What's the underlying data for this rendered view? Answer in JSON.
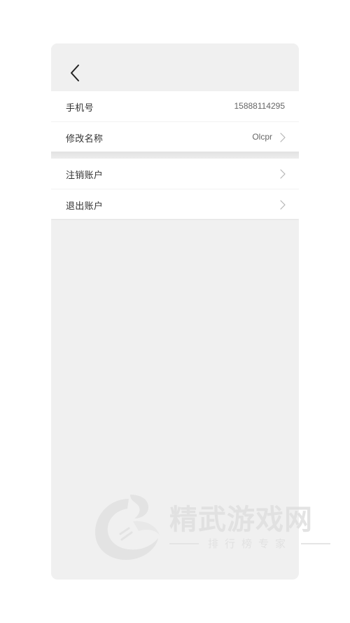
{
  "header": {
    "back_icon": "chevron-left-icon"
  },
  "account": {
    "phone_label": "手机号",
    "phone_value": "15888114295",
    "name_label": "修改名称",
    "name_value": "Olcpr"
  },
  "actions": {
    "cancel_account_label": "注销账户",
    "logout_label": "退出账户"
  },
  "watermark": {
    "title": "精武游戏网",
    "subtitle": "排行榜专家"
  },
  "colors": {
    "background": "#f0f0f0",
    "row_background": "#ffffff",
    "label_text": "#333333",
    "value_text": "#666666",
    "chevron": "#b5b5b5"
  }
}
